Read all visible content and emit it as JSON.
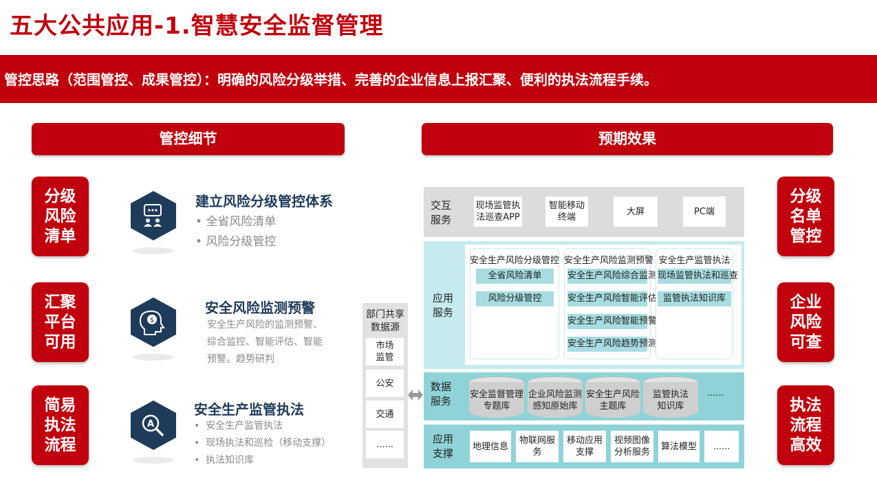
{
  "title": "五大公共应用-1.智慧安全监督管理",
  "banner": "管控思路（范围管控、成果管控）：明确的风险分级举措、完善的企业信息上报汇聚、便利的执法流程手续。",
  "left_header": "管控细节",
  "right_header": "预期效果",
  "left_badges": [
    {
      "lines": [
        "分级",
        "风险",
        "清单"
      ]
    },
    {
      "lines": [
        "汇聚",
        "平台",
        "可用"
      ]
    },
    {
      "lines": [
        "简易",
        "执法",
        "流程"
      ]
    }
  ],
  "right_badges": [
    {
      "lines": [
        "分级",
        "名单",
        "管控"
      ]
    },
    {
      "lines": [
        "企业",
        "风险",
        "可查"
      ]
    },
    {
      "lines": [
        "执法",
        "流程",
        "高效"
      ]
    }
  ],
  "details": [
    {
      "title": "建立风险分级管控体系",
      "icon": "chat-user-icon",
      "bullets": [
        "全省风险清单",
        "风险分级管控"
      ]
    },
    {
      "title": "安全风险监测预警",
      "icon": "head-dollar-icon",
      "text_lines": [
        "安全生产风险的监测预警、",
        "综合监控、智能评估、智能",
        "预警。趋势研判"
      ]
    },
    {
      "title": "安全生产监管执法",
      "icon": "magnifier-a-icon",
      "bullets": [
        "安全生产监管执法",
        "现场执法和巡检（移动支撑）",
        "执法知识库"
      ]
    }
  ],
  "source_panel": {
    "title_lines": [
      "部门共享",
      "数据源"
    ],
    "items": [
      "市场\n监管",
      "公安",
      "交通",
      "......"
    ]
  },
  "arch": {
    "interaction": {
      "label_lines": [
        "交互",
        "服务"
      ],
      "items": [
        "现场监管执\n法巡查APP",
        "智能移动\n终端",
        "大屏",
        "PC端"
      ]
    },
    "application": {
      "label_lines": [
        "应用",
        "服务"
      ],
      "panels": [
        {
          "title": "安全生产风险分级管控",
          "items": [
            "全省风险清单",
            "风险分级管控"
          ]
        },
        {
          "title": "安全生产风险监测预警",
          "items": [
            "安全生产风险综合监测",
            "安全生产风险智能评估",
            "安全生产风险智能预警",
            "安全生产风险趋势预测"
          ]
        },
        {
          "title": "安全生产监管执法",
          "items": [
            "现场监管执法和巡查",
            "监管执法知识库"
          ]
        }
      ]
    },
    "data": {
      "label_lines": [
        "数据",
        "服务"
      ],
      "items": [
        "安全监督管理\n专题库",
        "企业风险监测\n感知原始库",
        "安全生产风险\n主题库",
        "监管执法\n知识库"
      ],
      "more": "......"
    },
    "support": {
      "label_lines": [
        "应用",
        "支撑"
      ],
      "items": [
        "地理信息",
        "物联网服务",
        "移动应用\n支撑",
        "视频图像\n分析服务",
        "算法模型",
        "......"
      ]
    }
  },
  "colors": {
    "accent": "#c0000c",
    "navy": "#1f3b5a",
    "teal_band": "#8fd3d8",
    "light_teal": "#c6ebee",
    "gray_band": "#dcdcdc"
  }
}
